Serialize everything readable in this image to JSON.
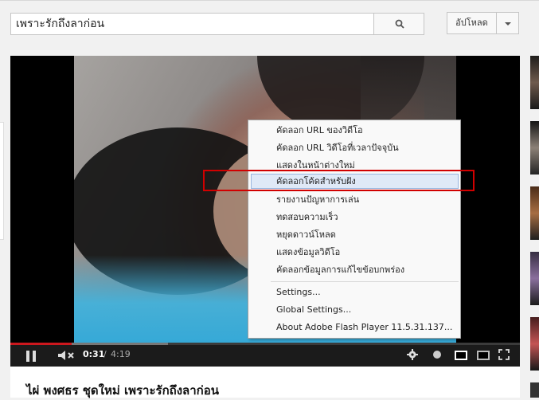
{
  "header": {
    "search_value": "เพราะรักถึงลาก่อน",
    "upload_label": "อัปโหลด",
    "search_icon": "search-icon",
    "menu_icon": "chevron-down-icon"
  },
  "player": {
    "current_time": "0:31",
    "time_separator": "/",
    "duration": "4:19",
    "progress_percent": 12,
    "buffered_percent": 31
  },
  "context_menu": {
    "items": [
      "คัดลอก URL ของวิดีโอ",
      "คัดลอก URL วิดีโอที่เวลาปัจจุบัน",
      "แสดงในหน้าต่างใหม่",
      "คัดลอกโค้ดสำหรับฝัง",
      "รายงานปัญหาการเล่น",
      "ทดสอบความเร็ว",
      "หยุดดาวน์โหลด",
      "แสดงข้อมูลวิดีโอ",
      "คัดลอกข้อมูลการแก้ไขข้อบกพร่อง",
      "Settings...",
      "Global Settings...",
      "About Adobe Flash Player 11.5.31.137..."
    ],
    "highlighted_index": 3,
    "highlight_color": "#d10000"
  },
  "video_title": "ไผ่ พงศธร ชุดใหม่ เพราะรักถึงลาก่อน",
  "colors": {
    "progress": "#cc181e",
    "page_bg": "#f1f1f1"
  }
}
